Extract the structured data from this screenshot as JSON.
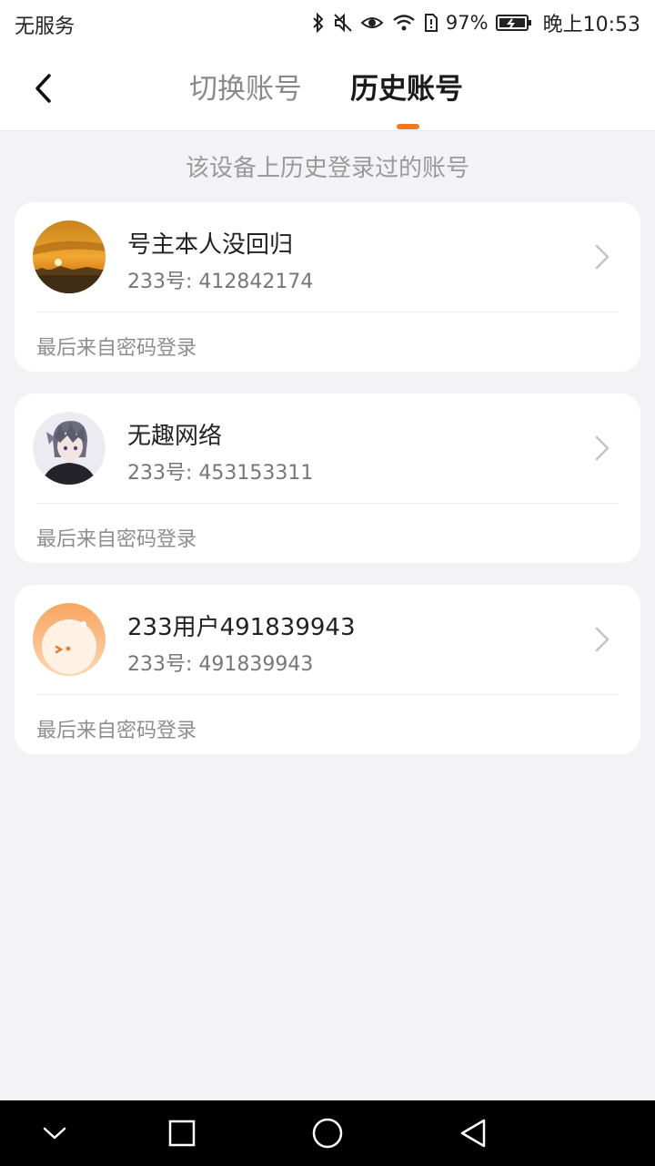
{
  "status_bar": {
    "carrier": "无服务",
    "battery_percent": "97%",
    "time": "晚上10:53",
    "icons": [
      "bluetooth-icon",
      "mute-icon",
      "eye-comfort-icon",
      "wifi-icon",
      "sim-alert-icon",
      "battery-charging-icon"
    ]
  },
  "header": {
    "back_icon": "chevron-left-icon",
    "tabs": [
      {
        "label": "切换账号",
        "active": false
      },
      {
        "label": "历史账号",
        "active": true
      }
    ],
    "accent_color": "#f07a22"
  },
  "subtitle": "该设备上历史登录过的账号",
  "accounts": [
    {
      "name": "号主本人没回归",
      "id_text": "233号: 412842174",
      "login_method": "最后来自密码登录",
      "avatar": "sunset-avatar"
    },
    {
      "name": "无趣网络",
      "id_text": "233号: 453153311",
      "login_method": "最后来自密码登录",
      "avatar": "anime-avatar"
    },
    {
      "name": "233用户491839943",
      "id_text": "233号: 491839943",
      "login_method": "最后来自密码登录",
      "avatar": "default-orange-avatar"
    }
  ],
  "nav_bar": {
    "icons": [
      "nav-collapse-icon",
      "nav-recents-icon",
      "nav-home-icon",
      "nav-back-icon"
    ]
  }
}
